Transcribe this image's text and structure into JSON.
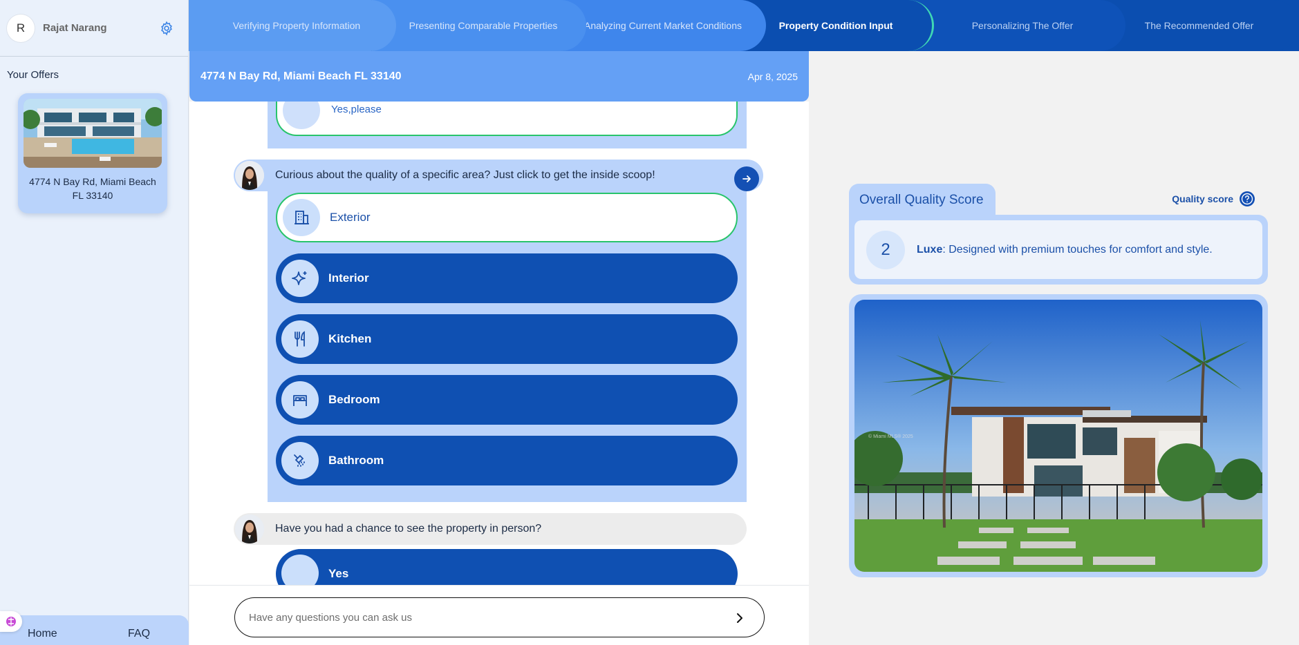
{
  "user": {
    "initial": "R",
    "name": "Rajat Narang"
  },
  "sidebar": {
    "offers_title": "Your Offers",
    "offers": [
      {
        "address": "4774 N Bay Rd, Miami Beach FL 33140"
      }
    ],
    "footer": {
      "home": "Home",
      "faq": "FAQ"
    }
  },
  "steps": [
    {
      "label": "Verifying Property Information",
      "state": "done"
    },
    {
      "label": "Presenting Comparable Properties",
      "state": "done"
    },
    {
      "label": "Analyzing Current Market Conditions",
      "state": "done"
    },
    {
      "label": "Property Condition Input",
      "state": "active"
    },
    {
      "label": "Personalizing The Offer",
      "state": "todo"
    },
    {
      "label": "The Recommended Offer",
      "state": "todo"
    }
  ],
  "header": {
    "address": "4774 N Bay Rd, Miami Beach FL 33140",
    "date": "Apr 8, 2025"
  },
  "chat": {
    "previous_answer": "Yes,please",
    "question1": "Curious about the quality of a specific area? Just click to get the inside scoop!",
    "options": [
      {
        "label": "Exterior",
        "icon": "building-icon",
        "selected": true
      },
      {
        "label": "Interior",
        "icon": "sparkle-icon",
        "selected": false
      },
      {
        "label": "Kitchen",
        "icon": "utensils-icon",
        "selected": false
      },
      {
        "label": "Bedroom",
        "icon": "bed-icon",
        "selected": false
      },
      {
        "label": "Bathroom",
        "icon": "shower-icon",
        "selected": false
      }
    ],
    "question2": "Have you had a chance to see the property in person?",
    "question2_option": "Yes"
  },
  "ask": {
    "placeholder": "Have any questions you can ask us"
  },
  "quality": {
    "title": "Overall Quality Score",
    "link": "Quality score",
    "score": "2",
    "level": "Luxe",
    "description": ": Designed with premium touches for comfort and style."
  },
  "photo": {
    "watermark": "© Miami MLS® 2025"
  },
  "colors": {
    "primary": "#0f50b2",
    "light": "#bad3fb",
    "selected_border": "#28c46b",
    "active_step_border": "#3fd8b4"
  }
}
